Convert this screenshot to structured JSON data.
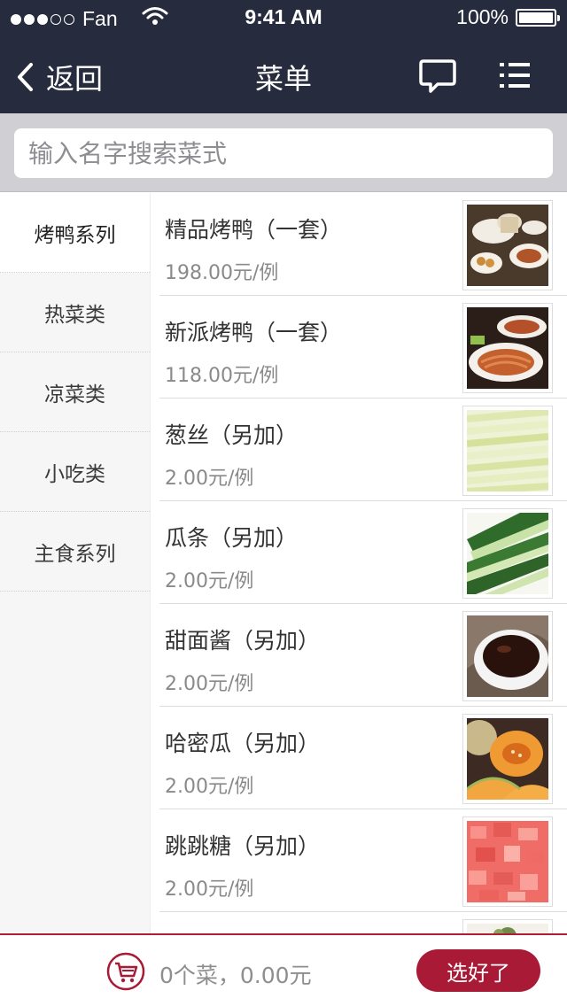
{
  "status_bar": {
    "carrier": "Fan",
    "time": "9:41 AM",
    "battery": "100%"
  },
  "nav": {
    "back_label": "返回",
    "title": "菜单"
  },
  "search": {
    "placeholder": "输入名字搜索菜式",
    "value": ""
  },
  "categories": [
    {
      "label": "烤鸭系列",
      "active": true
    },
    {
      "label": "热菜类"
    },
    {
      "label": "凉菜类"
    },
    {
      "label": "小吃类"
    },
    {
      "label": "主食系列"
    }
  ],
  "items": [
    {
      "name": "精品烤鸭（一套）",
      "price": "198.00元/例",
      "thumb": "roast-duck-set-image"
    },
    {
      "name": "新派烤鸭（一套）",
      "price": "118.00元/例",
      "thumb": "sliced-duck-image"
    },
    {
      "name": "葱丝（另加）",
      "price": "2.00元/例",
      "thumb": "scallion-strips-image"
    },
    {
      "name": "瓜条（另加）",
      "price": "2.00元/例",
      "thumb": "cucumber-strips-image"
    },
    {
      "name": "甜面酱（另加）",
      "price": "2.00元/例",
      "thumb": "sweet-bean-sauce-image"
    },
    {
      "name": "哈密瓜（另加）",
      "price": "2.00元/例",
      "thumb": "cantaloupe-image"
    },
    {
      "name": "跳跳糖（另加）",
      "price": "2.00元/例",
      "thumb": "popping-candy-image"
    }
  ],
  "cart": {
    "summary": "0个菜，0.00元",
    "done_label": "选好了"
  },
  "colors": {
    "header_bg": "#262b3d",
    "accent": "#a81a35",
    "search_bg": "#cfcfd4",
    "sidebar_bg": "#f6f6f6"
  }
}
